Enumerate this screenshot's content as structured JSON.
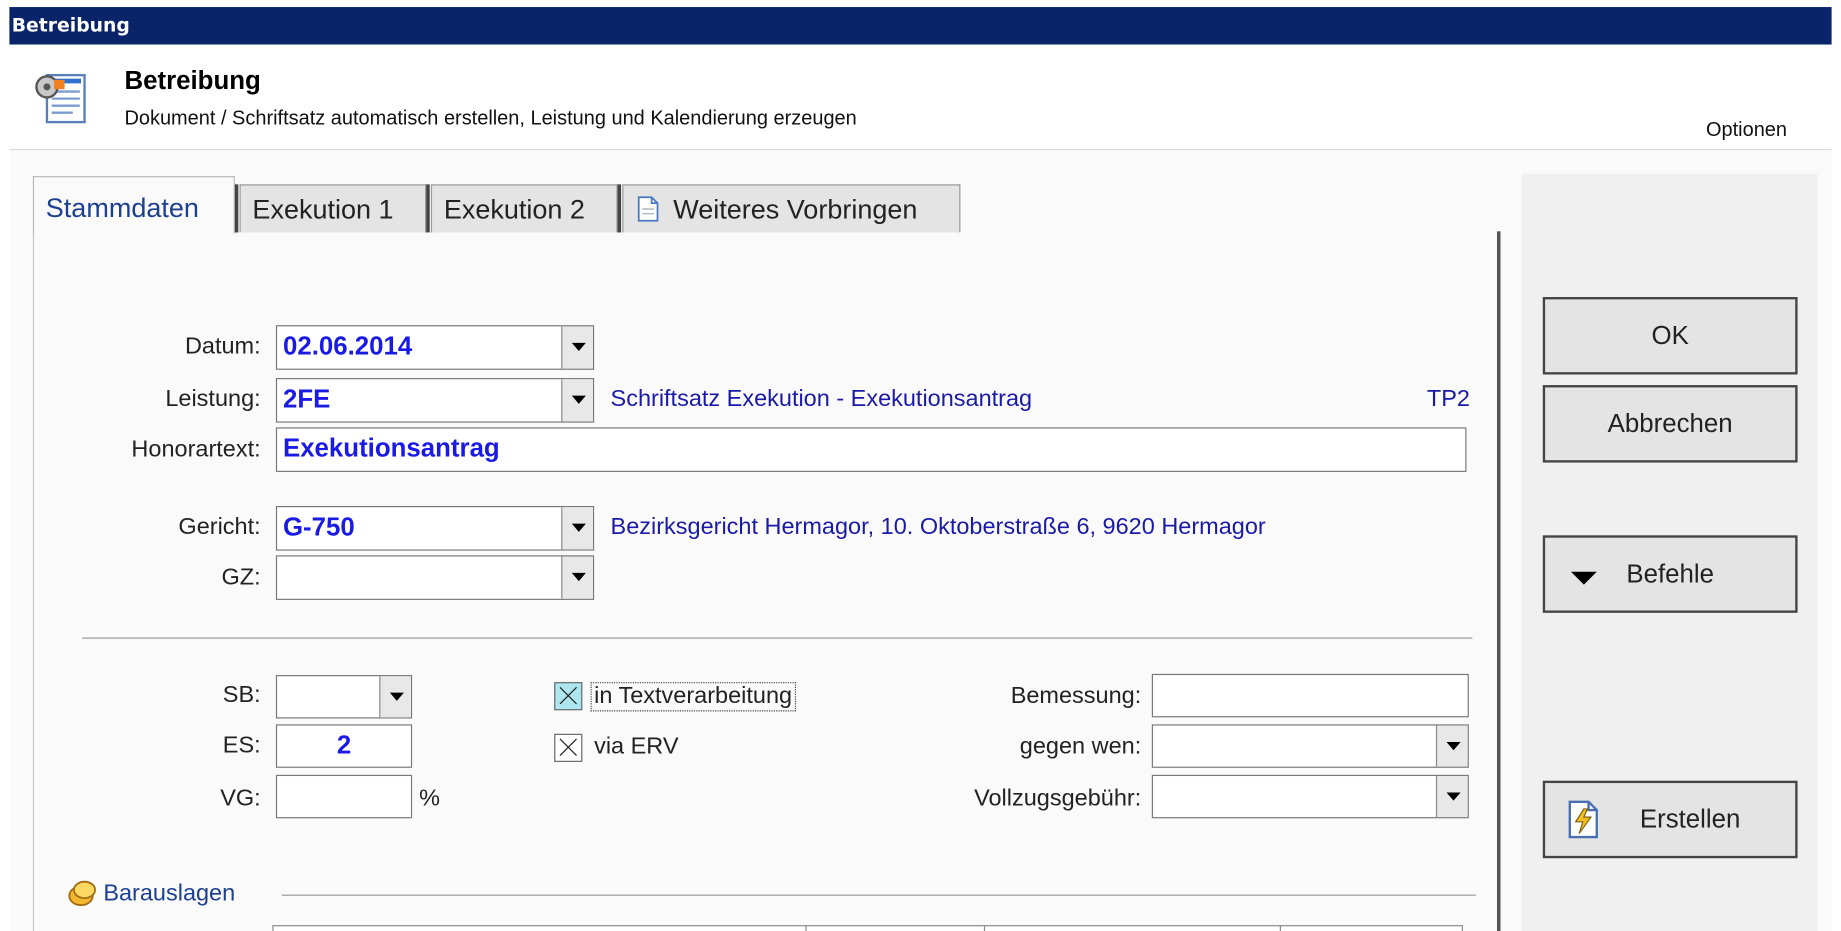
{
  "window": {
    "title": "Betreibung"
  },
  "header": {
    "title": "Betreibung",
    "subtitle": "Dokument / Schriftsatz automatisch erstellen, Leistung und Kalendierung erzeugen",
    "options_label": "Optionen"
  },
  "tabs": [
    {
      "label": "Stammdaten",
      "active": true
    },
    {
      "label": "Exekution 1"
    },
    {
      "label": "Exekution 2"
    },
    {
      "label": "Weiteres Vorbringen",
      "icon": "document-icon"
    }
  ],
  "form": {
    "datum": {
      "label": "Datum:",
      "value": "02.06.2014"
    },
    "leistung": {
      "label": "Leistung:",
      "value": "2FE",
      "description": "Schriftsatz Exekution - Exekutionsantrag",
      "code": "TP2"
    },
    "honorartext": {
      "label": "Honorartext:",
      "value": "Exekutionsantrag"
    },
    "gericht": {
      "label": "Gericht:",
      "value": "G-750",
      "description": "Bezirksgericht Hermagor, 10. Oktoberstraße 6, 9620 Hermagor"
    },
    "gz": {
      "label": "GZ:",
      "value": ""
    },
    "sb": {
      "label": "SB:",
      "value": ""
    },
    "es": {
      "label": "ES:",
      "value": "2"
    },
    "vg": {
      "label": "VG:",
      "value": "",
      "unit": "%"
    },
    "in_textverarbeitung": {
      "label": "in Textverarbeitung",
      "checked": true
    },
    "via_erv": {
      "label": "via ERV",
      "checked": true
    },
    "bemessung": {
      "label": "Bemessung:",
      "value": ""
    },
    "gegen_wen": {
      "label": "gegen wen:",
      "value": ""
    },
    "vollzugsgebuehr": {
      "label": "Vollzugsgebühr:",
      "value": ""
    },
    "barauslagen": {
      "label": "Barauslagen",
      "icon": "coins-icon"
    }
  },
  "buttons": {
    "ok": "OK",
    "cancel": "Abbrechen",
    "commands": "Befehle",
    "create": "Erstellen"
  },
  "colors": {
    "titlebar": "#0a246a",
    "field_text": "#1a1ae6",
    "label_blue": "#1a1aa8"
  }
}
